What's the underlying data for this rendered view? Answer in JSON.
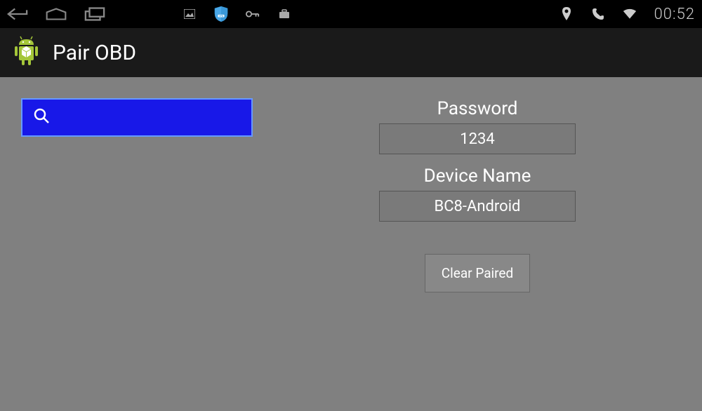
{
  "status": {
    "time": "00:52"
  },
  "app": {
    "title": "Pair OBD"
  },
  "form": {
    "password_label": "Password",
    "password_value": "1234",
    "device_name_label": "Device Name",
    "device_name_value": "BC8-Android",
    "clear_button_label": "Clear Paired"
  }
}
